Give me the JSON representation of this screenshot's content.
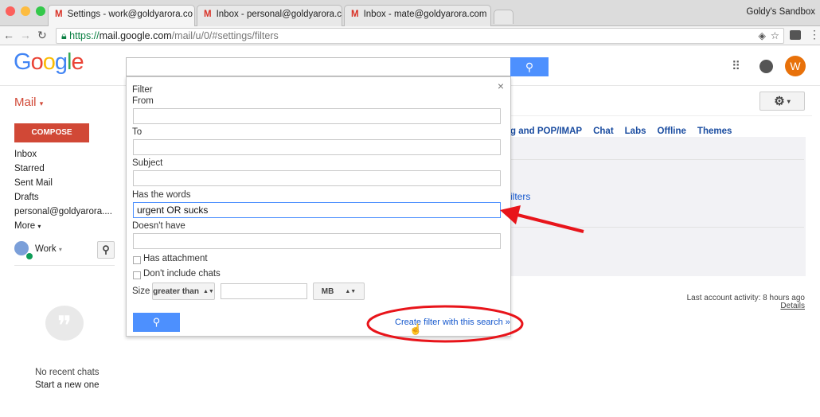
{
  "browser": {
    "tabs": [
      {
        "label": "Settings - work@goldyarora.co",
        "active": true
      },
      {
        "label": "Inbox - personal@goldyarora.c",
        "active": false
      },
      {
        "label": "Inbox - mate@goldyarora.com",
        "active": false
      }
    ],
    "profile": "Goldy's Sandbox",
    "url_scheme": "https://",
    "url_host": "mail.google.com",
    "url_path": "/mail/u/0/#settings/filters",
    "close": "x"
  },
  "header": {
    "logo": "Google",
    "avatar": "W",
    "search_value": ""
  },
  "sidebar": {
    "mail": "Mail",
    "compose": "COMPOSE",
    "items": [
      "Inbox",
      "Starred",
      "Sent Mail",
      "Drafts",
      "personal@goldyarora....",
      "More"
    ],
    "hangouts_user": "Work",
    "no_chats": "No recent chats",
    "start_chat": "Start a new one"
  },
  "settings": {
    "tabs": [
      "g and POP/IMAP",
      "Chat",
      "Labs",
      "Offline",
      "Themes"
    ],
    "partial_link": "ilters",
    "last_activity": "Last account activity: 8 hours ago",
    "details": "Details"
  },
  "filter": {
    "title": "Filter",
    "from_label": "From",
    "from": "",
    "to_label": "To",
    "to": "",
    "subject_label": "Subject",
    "subject": "",
    "has_words_label": "Has the words",
    "has_words": "urgent OR sucks",
    "doesnt_have_label": "Doesn't have",
    "doesnt_have": "",
    "has_attachment": "Has attachment",
    "has_attachment_checked": false,
    "no_chats": "Don't include chats",
    "no_chats_checked": false,
    "size_label": "Size",
    "size_op": "greater than",
    "size_value": "",
    "size_unit": "MB",
    "create_link": "Create filter with this search »",
    "close": "×"
  },
  "colors": {
    "accent_blue": "#4d90fe",
    "compose_red": "#d14836",
    "annotation_red": "#e8141a"
  }
}
